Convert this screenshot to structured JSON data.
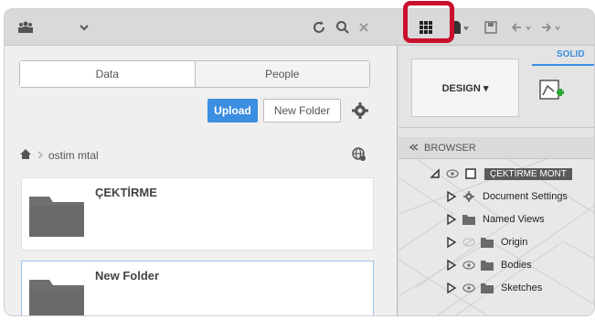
{
  "tabs": {
    "data": "Data",
    "people": "People"
  },
  "actions": {
    "upload": "Upload",
    "new_folder": "New Folder"
  },
  "breadcrumb": {
    "project": "ostim mtal"
  },
  "folders": [
    {
      "name": "ÇEKTİRME"
    },
    {
      "name": "New Folder"
    }
  ],
  "design": {
    "mode_label": "DESIGN ▾",
    "tab_solid": "SOLID"
  },
  "browser": {
    "title": "BROWSER",
    "root": "ÇEKTİRME MONT",
    "items": [
      {
        "label": "Document Settings",
        "icon": "gear-icon",
        "eye": false
      },
      {
        "label": "Named Views",
        "icon": "folder-icon",
        "eye": false
      },
      {
        "label": "Origin",
        "icon": "folder-icon",
        "eye": true,
        "eye_dim": true
      },
      {
        "label": "Bodies",
        "icon": "folder-icon",
        "eye": true
      },
      {
        "label": "Sketches",
        "icon": "folder-icon",
        "eye": true
      }
    ]
  },
  "colors": {
    "accent": "#3b8ee0",
    "highlight": "#c8102e",
    "folder": "#707070"
  }
}
